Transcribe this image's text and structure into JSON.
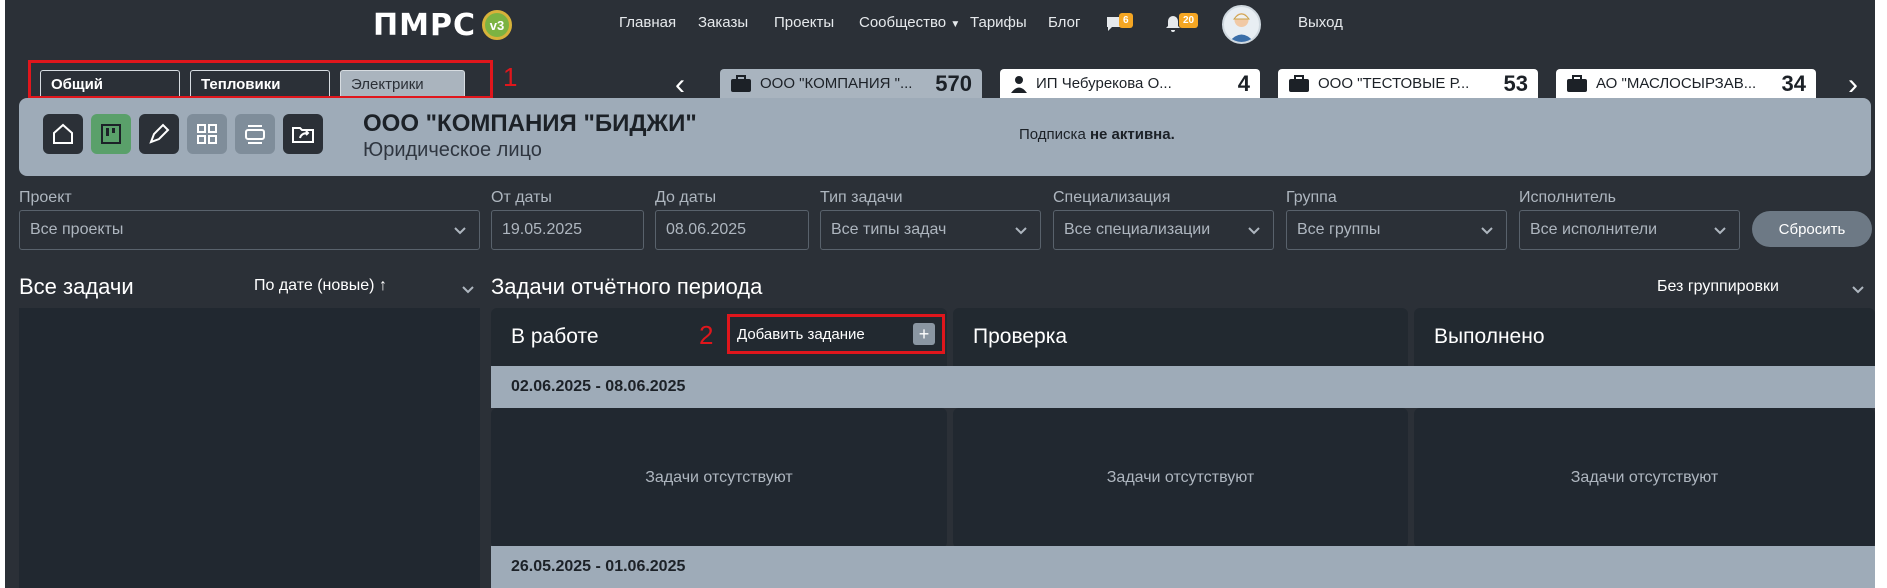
{
  "nav": {
    "logo_text": "ПМРС",
    "logo_badge": "v3",
    "links": [
      "Главная",
      "Заказы",
      "Проекты",
      "Сообщество",
      "Тарифы",
      "Блог"
    ],
    "messages_count": "6",
    "notifications_count": "20",
    "logout": "Выход"
  },
  "group_tabs": {
    "items": [
      "Общий",
      "Тепловики",
      "Электрики"
    ],
    "active": "Электрики",
    "annotation": "1"
  },
  "company_tabs": [
    {
      "name": "ООО \"КОМПАНИЯ \"...",
      "count": "570",
      "icon": "briefcase-icon"
    },
    {
      "name": "ИП Чебурекова О...",
      "count": "4",
      "icon": "person-icon"
    },
    {
      "name": "ООО \"ТЕСТОВЫЕ Р...",
      "count": "53",
      "icon": "briefcase-icon"
    },
    {
      "name": "АО \"МАСЛОСЫРЗАВ...",
      "count": "34",
      "icon": "briefcase-icon"
    }
  ],
  "header": {
    "company_name": "ООО \"КОМПАНИЯ \"БИДЖИ\"",
    "company_type": "Юридическое лицо",
    "subscription_prefix": "Подписка ",
    "subscription_status": "не активна."
  },
  "filters": {
    "project": {
      "label": "Проект",
      "value": "Все проекты"
    },
    "date_from": {
      "label": "От даты",
      "value": "19.05.2025"
    },
    "date_to": {
      "label": "До даты",
      "value": "08.06.2025"
    },
    "task_type": {
      "label": "Тип задачи",
      "value": "Все типы задач"
    },
    "specialization": {
      "label": "Специализация",
      "value": "Все специализации"
    },
    "group": {
      "label": "Группа",
      "value": "Все группы"
    },
    "executor": {
      "label": "Исполнитель",
      "value": "Все исполнители"
    },
    "reset": "Сбросить"
  },
  "all_tasks": {
    "title": "Все задачи",
    "sort": "По дате (новые) ↑"
  },
  "period": {
    "title": "Задачи отчётного периода",
    "grouping": "Без группировки",
    "columns": [
      "В работе",
      "Проверка",
      "Выполнено"
    ],
    "add_task": "Добавить задание",
    "annotation": "2",
    "ranges": [
      "02.06.2025 - 08.06.2025",
      "26.05.2025 - 01.06.2025"
    ],
    "empty": "Задачи отсутствуют"
  },
  "colors": {
    "accent_red": "#e0161c",
    "badge_orange": "#f5a623",
    "panel": "#9eabb8",
    "bg": "#2b3037"
  }
}
